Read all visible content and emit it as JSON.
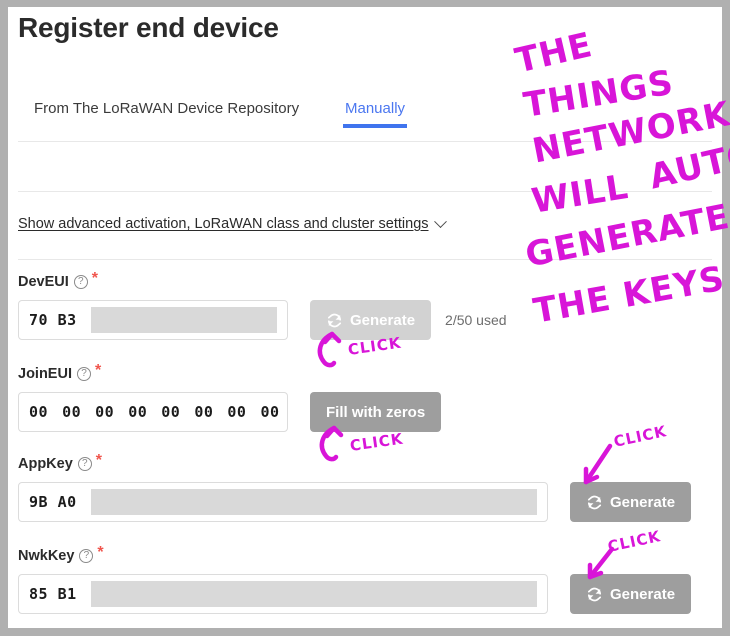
{
  "window": {
    "title": "Register end device",
    "accent_color": "#3f74ee",
    "required_color": "#f0554d",
    "ink_color": "#d815d8"
  },
  "tabs": [
    {
      "id": "repository",
      "label": "From The LoRaWAN Device Repository",
      "active": false
    },
    {
      "id": "manually",
      "label": "Manually",
      "active": true
    }
  ],
  "advanced": {
    "label": "Show advanced activation, LoRaWAN class and cluster settings",
    "chevron_icon": "chevron-down-icon"
  },
  "fields": [
    {
      "id": "deveui",
      "label": "DevEUI",
      "help_icon": "help-circle-icon",
      "required_marker": "*",
      "value_prefix": "70 B3",
      "redacted": true,
      "button": {
        "label": "Generate",
        "icon": "refresh-icon",
        "state": "disabled"
      },
      "meta": "2/50 used"
    },
    {
      "id": "joineui",
      "label": "JoinEUI",
      "help_icon": "help-circle-icon",
      "required_marker": "*",
      "bytes": [
        "00",
        "00",
        "00",
        "00",
        "00",
        "00",
        "00",
        "00"
      ],
      "redacted": false,
      "button": {
        "label": "Fill with zeros",
        "icon": null,
        "state": "enabled"
      },
      "meta": ""
    },
    {
      "id": "appkey",
      "label": "AppKey",
      "help_icon": "help-circle-icon",
      "required_marker": "*",
      "value_prefix": "9B A0",
      "redacted": true,
      "button": {
        "label": "Generate",
        "icon": "refresh-icon",
        "state": "enabled"
      },
      "meta": ""
    },
    {
      "id": "nwkkey",
      "label": "NwkKey",
      "help_icon": "help-circle-icon",
      "required_marker": "*",
      "value_prefix": "85 B1",
      "redacted": true,
      "button": {
        "label": "Generate",
        "icon": "refresh-icon",
        "state": "enabled"
      },
      "meta": ""
    }
  ],
  "annotations": {
    "headline_words": [
      "THE",
      "THINGS",
      "NETWORK",
      "WILL",
      "AUTO",
      "GENERATE",
      "THE KEYS"
    ],
    "click_labels": [
      "CLICK",
      "CLICK",
      "CLICK",
      "CLICK"
    ]
  }
}
